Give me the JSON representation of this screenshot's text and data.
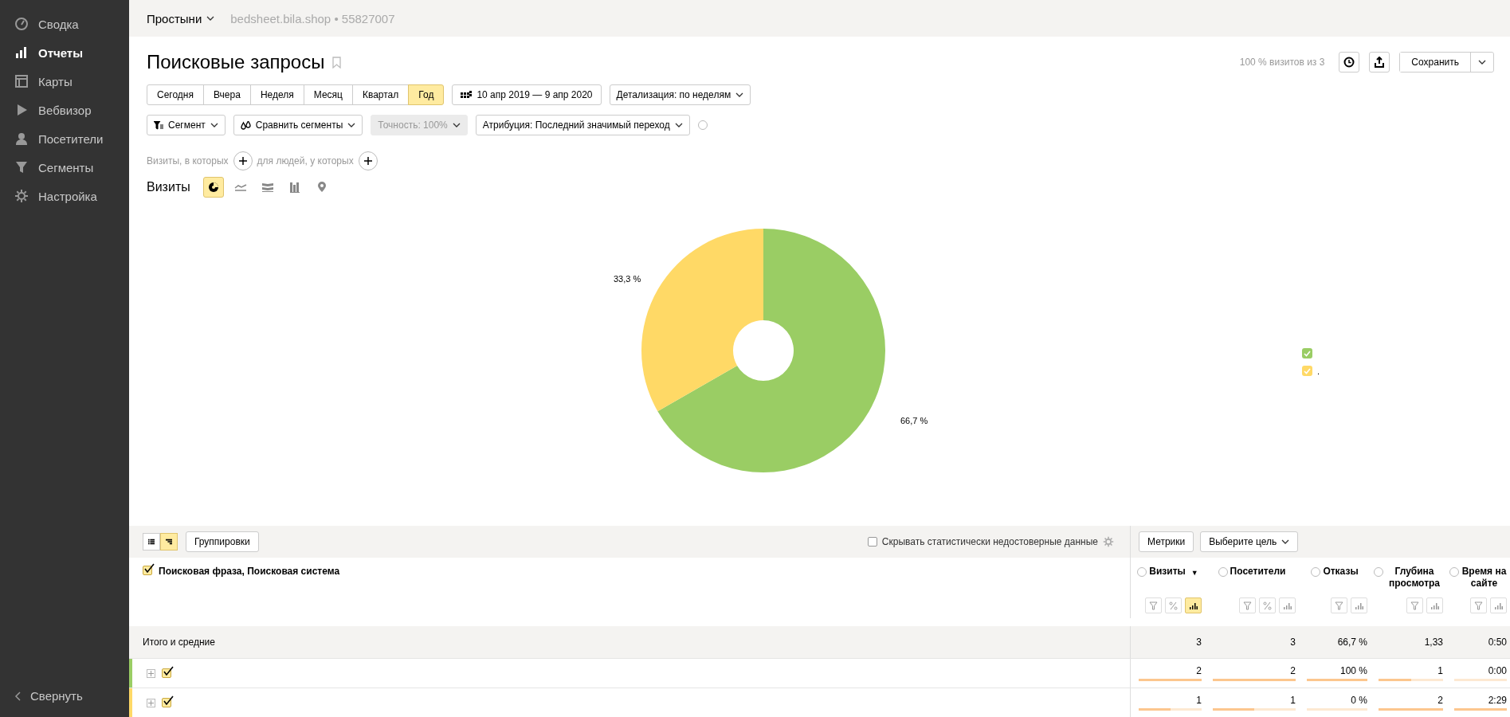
{
  "sidebar": {
    "items": [
      {
        "label": "Сводка",
        "selected": false
      },
      {
        "label": "Отчеты",
        "selected": true
      },
      {
        "label": "Карты",
        "selected": false
      },
      {
        "label": "Вебвизор",
        "selected": false
      },
      {
        "label": "Посетители",
        "selected": false
      },
      {
        "label": "Сегменты",
        "selected": false
      },
      {
        "label": "Настройка",
        "selected": false
      }
    ],
    "collapse": "Свернуть"
  },
  "topbar": {
    "counter": "Простыни",
    "site": "bedsheet.bila.shop • 55827007"
  },
  "header": {
    "title": "Поисковые запросы",
    "sample": "100 % визитов из 3",
    "save": "Сохранить"
  },
  "periods": [
    {
      "label": "Сегодня",
      "selected": false
    },
    {
      "label": "Вчера",
      "selected": false
    },
    {
      "label": "Неделя",
      "selected": false
    },
    {
      "label": "Месяц",
      "selected": false
    },
    {
      "label": "Квартал",
      "selected": false
    },
    {
      "label": "Год",
      "selected": true
    }
  ],
  "date_range": "10 апр 2019 — 9 апр 2020",
  "detail": "Детализация: по неделям",
  "filters": {
    "segment": "Сегмент",
    "compare": "Сравнить сегменты",
    "accuracy": {
      "label": "Точность: 100%",
      "disabled": true
    },
    "attribution": "Атрибуция: Последний значимый переход"
  },
  "conditions": [
    "Визиты, в которых",
    "для людей, у которых"
  ],
  "chart": {
    "metric": "Визиты",
    "types": [
      {
        "selected": true
      },
      {
        "selected": false
      },
      {
        "selected": false
      },
      {
        "selected": false
      },
      {
        "selected": false
      }
    ],
    "chart_data": {
      "type": "donut",
      "values": [
        66.7,
        33.3
      ],
      "value_labels": [
        "66,7 %",
        "33,3 %"
      ],
      "data_labels": true
    },
    "legend": [
      {
        "color": "#9acd64",
        "checked": true
      },
      {
        "color": "#ffd966",
        "checked": true,
        "label": "."
      }
    ]
  },
  "table": {
    "view_modes": [
      {
        "selected": false
      },
      {
        "selected": true
      }
    ],
    "groupings": "Группировки",
    "hide_unreliable": {
      "label": "Скрывать статистически недостоверные данные",
      "checked": false
    },
    "metrics_button": "Метрики",
    "goal": "Выберите цель",
    "dimension": {
      "label": "Поисковая фраза, Поисковая система",
      "checked": true
    },
    "columns": [
      {
        "label": "Визиты",
        "sort_mark": "▼",
        "tools": [
          {
            "kind": "filter",
            "selected": false
          },
          {
            "kind": "percent",
            "selected": false
          },
          {
            "kind": "bars",
            "selected": true
          }
        ]
      },
      {
        "label": "Посетители",
        "tools": [
          {
            "kind": "filter",
            "selected": false
          },
          {
            "kind": "percent",
            "selected": false
          },
          {
            "kind": "bars",
            "selected": false
          }
        ]
      },
      {
        "label": "Отказы",
        "tools": [
          {
            "kind": "filter",
            "selected": false
          },
          {
            "kind": "bars",
            "selected": false
          }
        ]
      },
      {
        "label": "Глубина просмотра",
        "tools": [
          {
            "kind": "filter",
            "selected": false
          },
          {
            "kind": "bars",
            "selected": false
          }
        ]
      },
      {
        "label": "Время на сайте",
        "tools": [
          {
            "kind": "filter",
            "selected": false
          },
          {
            "kind": "bars",
            "selected": false
          }
        ]
      }
    ],
    "totals": {
      "label": "Итого и средние",
      "values": [
        "3",
        "3",
        "66,7 %",
        "1,33",
        "0:50"
      ]
    },
    "rows": [
      {
        "color": "#9acd64",
        "checked": true,
        "cells": [
          {
            "value": "2",
            "level": 1
          },
          {
            "value": "2",
            "level": 1
          },
          {
            "value": "100 %",
            "level": 1
          },
          {
            "value": "1",
            "level": 0.5
          },
          {
            "value": "0:00",
            "level": 0
          }
        ]
      },
      {
        "color": "#ffd966",
        "checked": true,
        "cells": [
          {
            "value": "1",
            "level": 0.5
          },
          {
            "value": "1",
            "level": 0.5
          },
          {
            "value": "0 %",
            "level": 0
          },
          {
            "value": "2",
            "level": 1
          },
          {
            "value": "2:29",
            "level": 1
          }
        ]
      }
    ]
  }
}
